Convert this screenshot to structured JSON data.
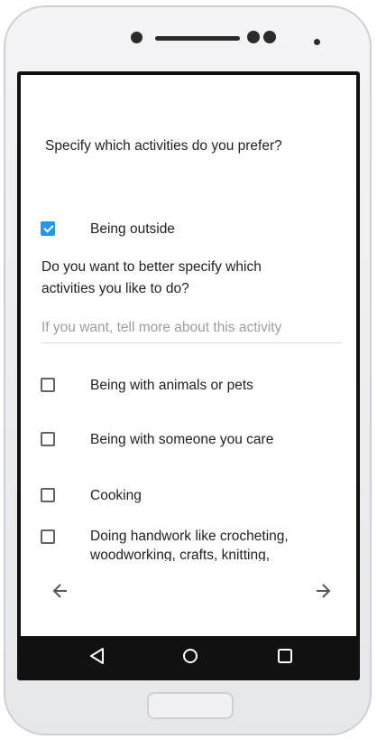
{
  "question": "Specify which activities do you prefer?",
  "activities": [
    {
      "label": "Being outside",
      "checked": true
    },
    {
      "label": "Being with animals or pets",
      "checked": false
    },
    {
      "label": "Being with someone you care",
      "checked": false
    },
    {
      "label": "Cooking",
      "checked": false
    },
    {
      "label": "Doing handwork like crocheting, woodworking, crafts, knitting,",
      "checked": false
    }
  ],
  "followup": {
    "question": "Do you want to better specify which activities you like to do?",
    "placeholder": "If you want, tell more about this activity"
  },
  "nav": {
    "back_icon": "arrow-left-icon",
    "forward_icon": "arrow-right-icon"
  },
  "system_nav": {
    "back_icon": "triangle-back-icon",
    "home_icon": "circle-home-icon",
    "recents_icon": "square-recents-icon"
  },
  "colors": {
    "accent": "#2196f3",
    "nav_bar": "#111111"
  }
}
